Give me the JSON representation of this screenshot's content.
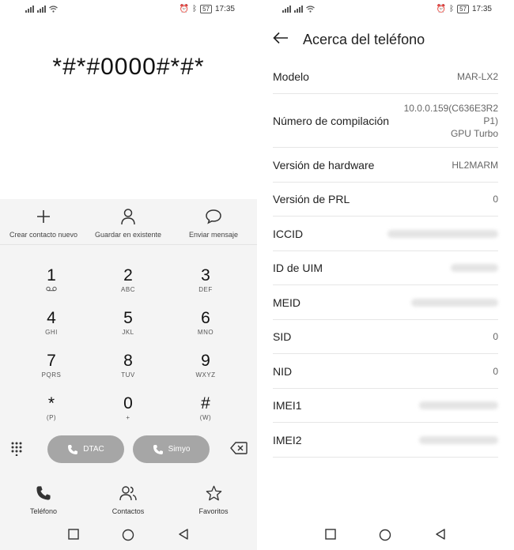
{
  "status": {
    "battery": "57",
    "time": "17:35"
  },
  "dialer": {
    "display": "*#*#0000#*#*",
    "actions": [
      {
        "label": "Crear contacto nuevo",
        "icon": "plus-icon"
      },
      {
        "label": "Guardar en existente",
        "icon": "person-icon"
      },
      {
        "label": "Enviar mensaje",
        "icon": "message-icon"
      }
    ],
    "keys": [
      {
        "num": "1",
        "sub": "voicemail"
      },
      {
        "num": "2",
        "sub": "ABC"
      },
      {
        "num": "3",
        "sub": "DEF"
      },
      {
        "num": "4",
        "sub": "GHI"
      },
      {
        "num": "5",
        "sub": "JKL"
      },
      {
        "num": "6",
        "sub": "MNO"
      },
      {
        "num": "7",
        "sub": "PQRS"
      },
      {
        "num": "8",
        "sub": "TUV"
      },
      {
        "num": "9",
        "sub": "WXYZ"
      },
      {
        "num": "*",
        "sub": "(P)"
      },
      {
        "num": "0",
        "sub": "+"
      },
      {
        "num": "#",
        "sub": "(W)"
      }
    ],
    "call_buttons": [
      {
        "label": "DTAC",
        "sim": "1"
      },
      {
        "label": "Simyo",
        "sim": "2"
      }
    ],
    "nav": [
      {
        "label": "Teléfono",
        "icon": "phone-icon"
      },
      {
        "label": "Contactos",
        "icon": "contacts-icon"
      },
      {
        "label": "Favoritos",
        "icon": "star-icon"
      }
    ]
  },
  "about": {
    "title": "Acerca del teléfono",
    "rows": [
      {
        "key": "Modelo",
        "value": "MAR-LX2"
      },
      {
        "key": "Número de compilación",
        "value_lines": [
          "10.0.0.159(C636E3R2",
          "P1)",
          "GPU Turbo"
        ]
      },
      {
        "key": "Versión de hardware",
        "value": "HL2MARM"
      },
      {
        "key": "Versión de PRL",
        "value": "0"
      },
      {
        "key": "ICCID",
        "value": "",
        "blurred": true
      },
      {
        "key": "ID de UIM",
        "value": "",
        "blurred": true
      },
      {
        "key": "MEID",
        "value": "",
        "blurred": true
      },
      {
        "key": "SID",
        "value": "0"
      },
      {
        "key": "NID",
        "value": "0"
      },
      {
        "key": "IMEI1",
        "value": "",
        "blurred": true
      },
      {
        "key": "IMEI2",
        "value": "",
        "blurred": true
      }
    ]
  }
}
